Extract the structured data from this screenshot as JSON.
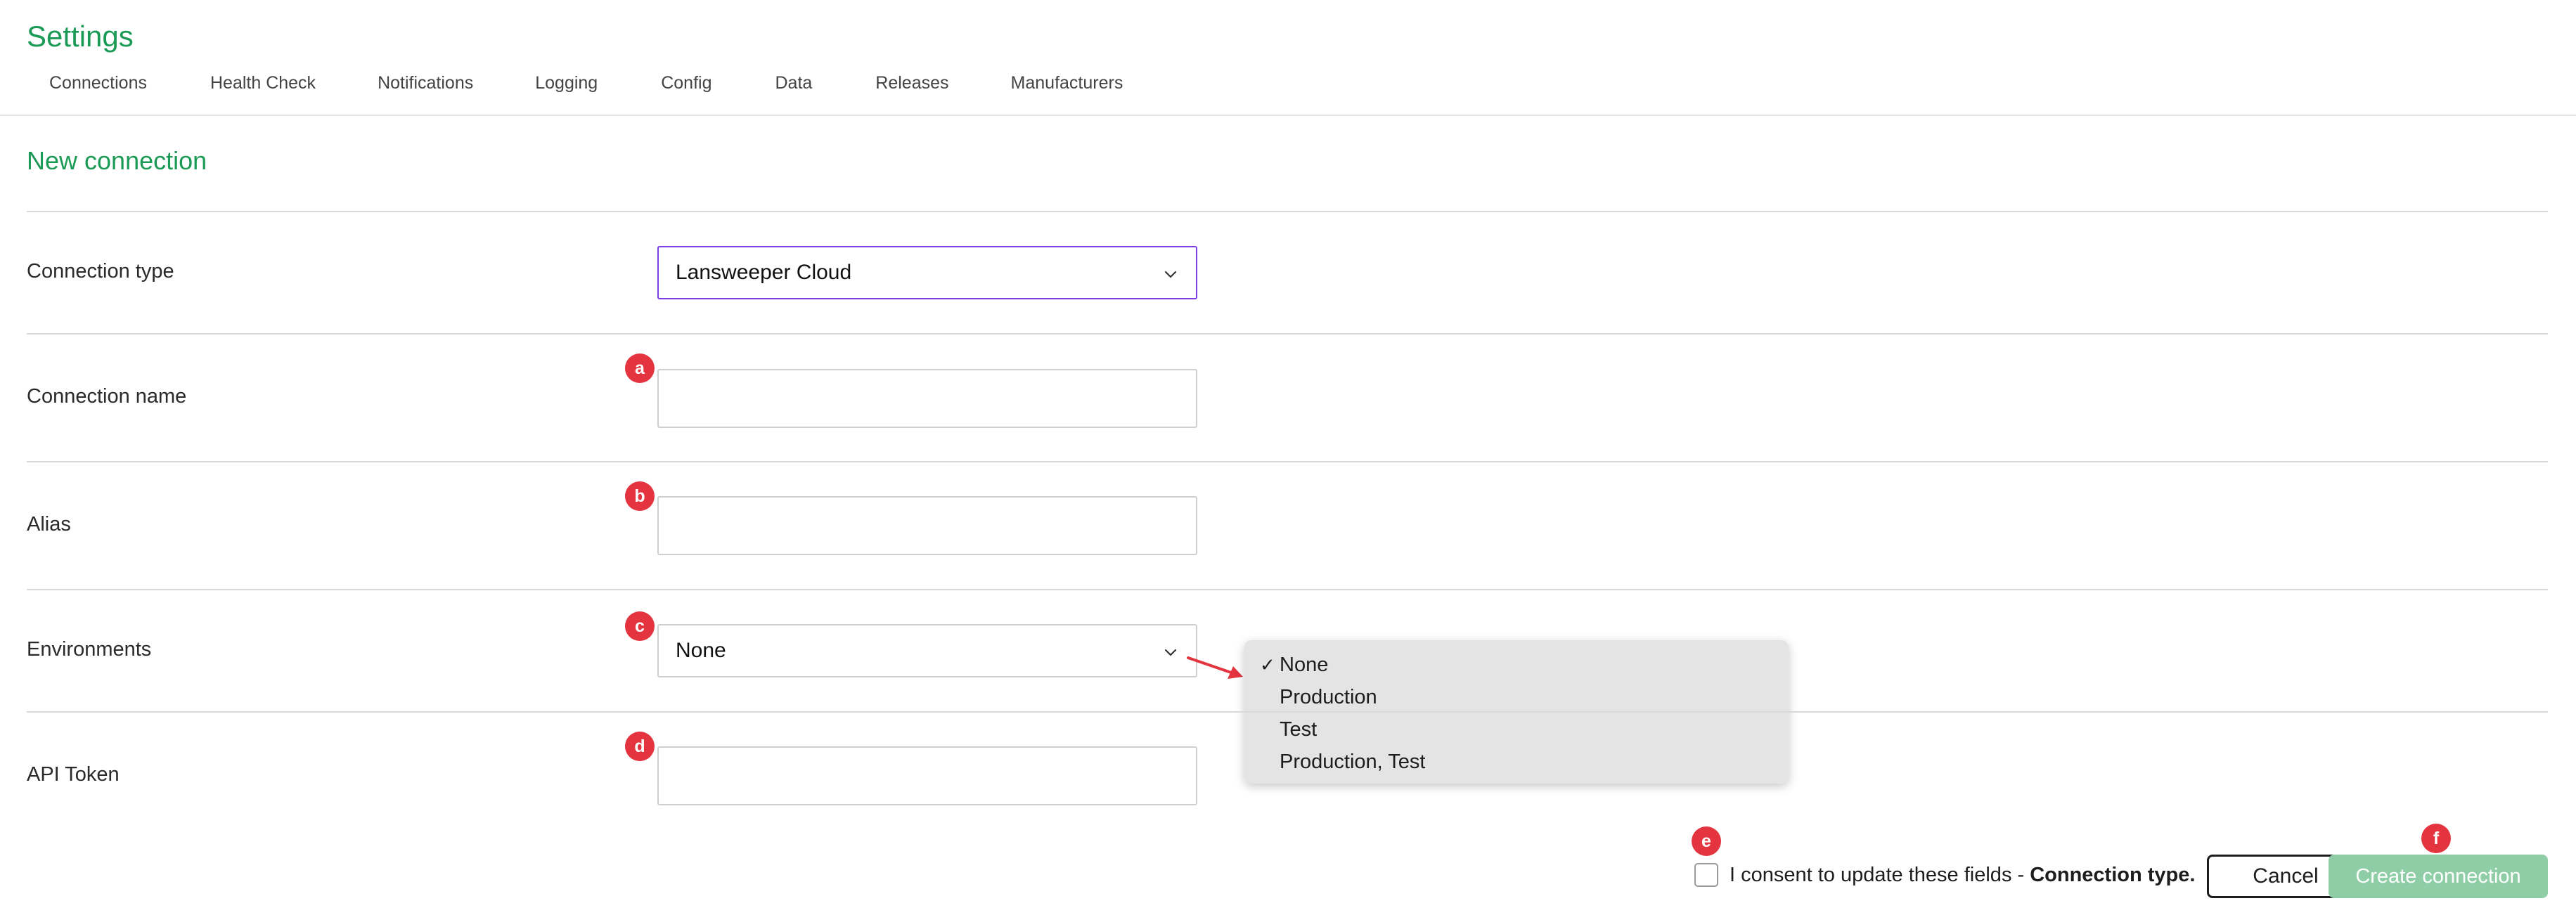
{
  "header": {
    "title": "Settings",
    "tabs": [
      {
        "label": "Connections"
      },
      {
        "label": "Health Check"
      },
      {
        "label": "Notifications"
      },
      {
        "label": "Logging"
      },
      {
        "label": "Config"
      },
      {
        "label": "Data"
      },
      {
        "label": "Releases"
      },
      {
        "label": "Manufacturers"
      }
    ]
  },
  "form": {
    "title": "New connection",
    "connection_type": {
      "label": "Connection type",
      "value": "Lansweeper Cloud"
    },
    "connection_name": {
      "label": "Connection name",
      "value": "",
      "badge": "a"
    },
    "alias": {
      "label": "Alias",
      "value": "",
      "badge": "b"
    },
    "environments": {
      "label": "Environments",
      "value": "None",
      "badge": "c",
      "options": [
        {
          "label": "None",
          "selected": true
        },
        {
          "label": "Production",
          "selected": false
        },
        {
          "label": "Test",
          "selected": false
        },
        {
          "label": "Production, Test",
          "selected": false
        }
      ]
    },
    "api_token": {
      "label": "API Token",
      "value": "",
      "badge": "d"
    }
  },
  "footer": {
    "consent_badge": "e",
    "consent_text": "I consent to update these fields - ",
    "consent_bold": "Connection type.",
    "consent_checked": false,
    "cancel_label": "Cancel",
    "create_badge": "f",
    "create_label": "Create connection"
  },
  "colors": {
    "accent_green": "#1a9a55",
    "focus_purple": "#7b3fe4",
    "badge_red": "#e3343f",
    "disabled_button": "#8fcda7",
    "arrow_red": "#e3343f"
  },
  "icons": {
    "select_chevron": "chevron-down-icon",
    "selected_check": "check-icon",
    "callout_arrow": "arrow-icon"
  }
}
